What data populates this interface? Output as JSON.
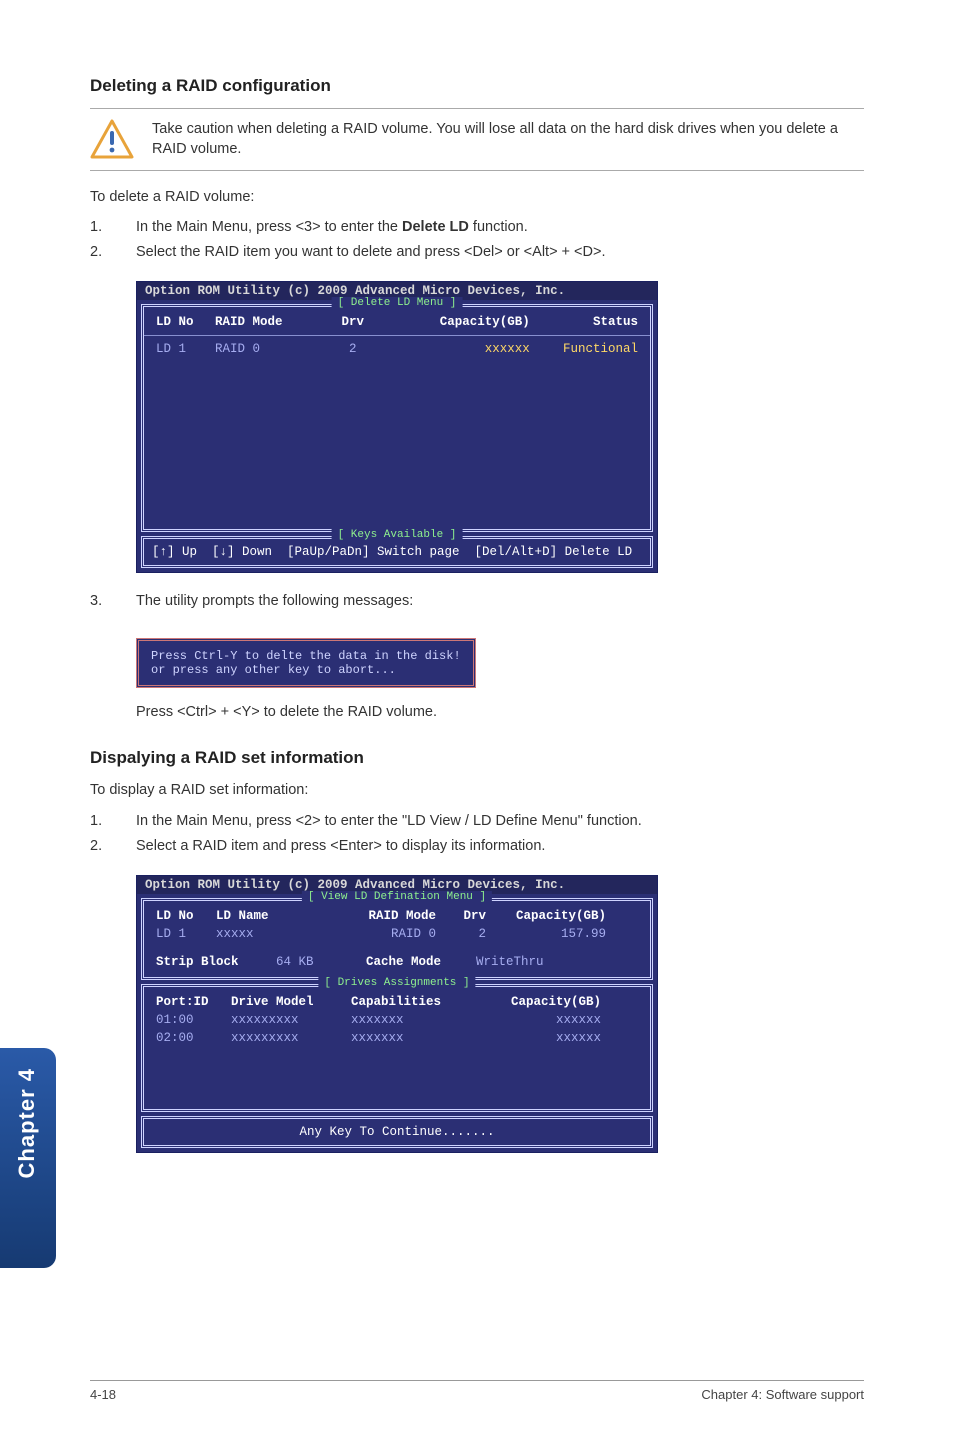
{
  "section1": {
    "heading": "Deleting a RAID configuration",
    "warning": "Take caution when deleting a RAID volume. You will lose all data on the hard disk drives when you delete a RAID volume.",
    "intro": "To delete a RAID volume:",
    "steps": [
      {
        "n": "1.",
        "t": "In the Main Menu, press <3> to enter the Delete LD function.",
        "bold": "Delete LD"
      },
      {
        "n": "2.",
        "t": "Select the RAID item you want to delete and press <Del> or <Alt> + <D>."
      }
    ],
    "term_title": "Option ROM Utility (c) 2009 Advanced Micro Devices, Inc.",
    "box_label": "[ Delete LD Menu ]",
    "columns": {
      "c1": "LD No",
      "c2": "RAID Mode",
      "c3": "Drv",
      "c4": "Capacity(GB)",
      "c5": "Status"
    },
    "row": {
      "c1": "LD  1",
      "c2": "RAID 0",
      "c3": "2",
      "c4": "xxxxxx",
      "c5": "Functional"
    },
    "keys_label": "[ Keys Available ]",
    "keys": "[↑] Up  [↓] Down  [PaUp/PaDn] Switch page  [Del/Alt+D] Delete LD",
    "step3": {
      "n": "3.",
      "t": "The utility prompts the following messages:"
    },
    "prompt_l1": "Press Ctrl-Y to delte the data in the disk!",
    "prompt_l2": "or press any other key to abort...",
    "after": "Press <Ctrl> + <Y> to delete the RAID volume."
  },
  "section2": {
    "heading": "Dispalying a RAID set information",
    "intro": "To display a RAID set information:",
    "steps": [
      {
        "n": "1.",
        "t": "In the Main Menu, press <2> to enter the \"LD View / LD Define Menu\" function."
      },
      {
        "n": "2.",
        "t": "Select a RAID item and press <Enter> to display its information."
      }
    ],
    "term_title": "Option ROM Utility (c) 2009 Advanced Micro Devices, Inc.",
    "box_label": "[ View LD Defination Menu ]",
    "vcols": {
      "c1": "LD No",
      "c2": "LD Name",
      "c3": "RAID Mode",
      "c4": "Drv",
      "c5": "Capacity(GB)"
    },
    "vrow": {
      "c1": "LD  1",
      "c2": "xxxxx",
      "c3": "RAID 0",
      "c4": "2",
      "c5": "157.99"
    },
    "strip_l": "Strip Block",
    "strip_v": "64 KB",
    "cache_l": "Cache Mode",
    "cache_v": "WriteThru",
    "d_label": "[ Drives Assignments ]",
    "dcols": {
      "c1": "Port:ID",
      "c2": "Drive Model",
      "c3": "Capabilities",
      "c4": "Capacity(GB)"
    },
    "drows": [
      {
        "c1": "01:00",
        "c2": "xxxxxxxxx",
        "c3": "xxxxxxx",
        "c4": "xxxxxx"
      },
      {
        "c1": "02:00",
        "c2": "xxxxxxxxx",
        "c3": "xxxxxxx",
        "c4": "xxxxxx"
      }
    ],
    "any_key": "Any Key To Continue......."
  },
  "sidebar": "Chapter 4",
  "footer": {
    "left": "4-18",
    "right": "Chapter 4: Software support"
  }
}
